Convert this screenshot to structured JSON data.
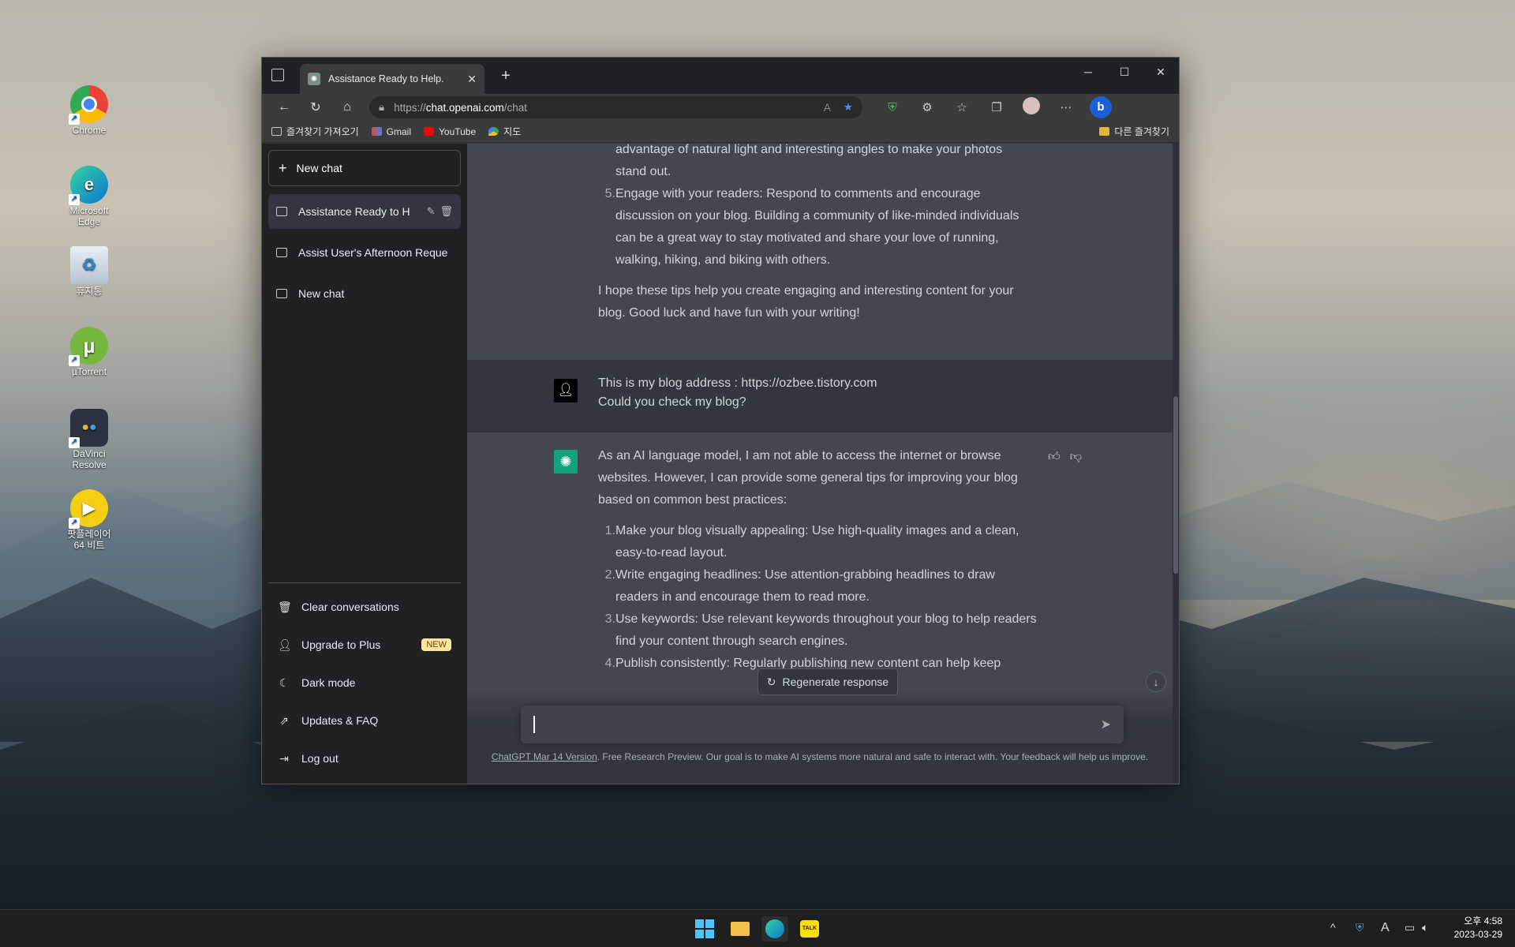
{
  "desktop": {
    "icons": [
      {
        "label": "Chrome"
      },
      {
        "label": "Microsoft Edge"
      },
      {
        "label": "휴지통"
      },
      {
        "label": "µTorrent"
      },
      {
        "label": "DaVinci Resolve"
      },
      {
        "label": "팟플레이어 64 비트"
      }
    ]
  },
  "browser": {
    "tab_title": "Assistance Ready to Help.",
    "url_prefix": "https://",
    "url_host": "chat.openai.com",
    "url_path": "/chat",
    "bookmarks": [
      "즐겨찾기 가져오기",
      "Gmail",
      "YouTube",
      "지도"
    ],
    "other_favorites": "다른 즐겨찾기"
  },
  "sidebar": {
    "new_chat": "New chat",
    "conversations": [
      {
        "title": "Assistance Ready to H"
      },
      {
        "title": "Assist User's Afternoon Reque"
      },
      {
        "title": "New chat"
      }
    ],
    "footer": [
      {
        "label": "Clear conversations",
        "icon": "trash-icon"
      },
      {
        "label": "Upgrade to Plus",
        "icon": "user-icon",
        "badge": "NEW"
      },
      {
        "label": "Dark mode",
        "icon": "moon-icon"
      },
      {
        "label": "Updates & FAQ",
        "icon": "external-link-icon"
      },
      {
        "label": "Log out",
        "icon": "logout-icon"
      }
    ]
  },
  "chat": {
    "prev_tail_line": "advantage of natural light and interesting angles to make your photos",
    "prev_tail_line2": "stand out.",
    "prev_item5_num": "5.",
    "prev_item5": "Engage with your readers: Respond to comments and encourage discussion on your blog. Building a community of like-minded individuals can be a great way to stay motivated and share your love of running, walking, hiking, and biking with others.",
    "prev_closing": "I hope these tips help you create engaging and interesting content for your blog. Good luck and have fun with your writing!",
    "user_line1": "This is my blog address :  https://ozbee.tistory.com",
    "user_line2": "Could you check my blog?",
    "bot_intro": "As an AI language model, I am not able to access the internet or browse websites. However, I can provide some general tips for improving your blog based on common best practices:",
    "bot_items": [
      {
        "num": "1.",
        "text": "Make your blog visually appealing: Use high-quality images and a clean, easy-to-read layout."
      },
      {
        "num": "2.",
        "text": "Write engaging headlines: Use attention-grabbing headlines to draw readers in and encourage them to read more."
      },
      {
        "num": "3.",
        "text": "Use keywords: Use relevant keywords throughout your blog to help readers find your content through search engines."
      },
      {
        "num": "4.",
        "text": "Publish consistently: Regularly publishing new content can help keep"
      }
    ],
    "regenerate": "Regenerate response",
    "input_placeholder": "",
    "footer_link": "ChatGPT Mar 14 Version",
    "footer_text": ". Free Research Preview. Our goal is to make AI systems more natural and safe to interact with. Your feedback will help us improve."
  },
  "taskbar": {
    "time": "오후 4:58",
    "date": "2023-03-29",
    "ime": "A"
  },
  "colors": {
    "sidebar_bg": "#202123",
    "main_bg": "#343541",
    "bot_bg": "#444654",
    "gpt_green": "#10a37f",
    "badge_yellow": "#fae69e"
  }
}
